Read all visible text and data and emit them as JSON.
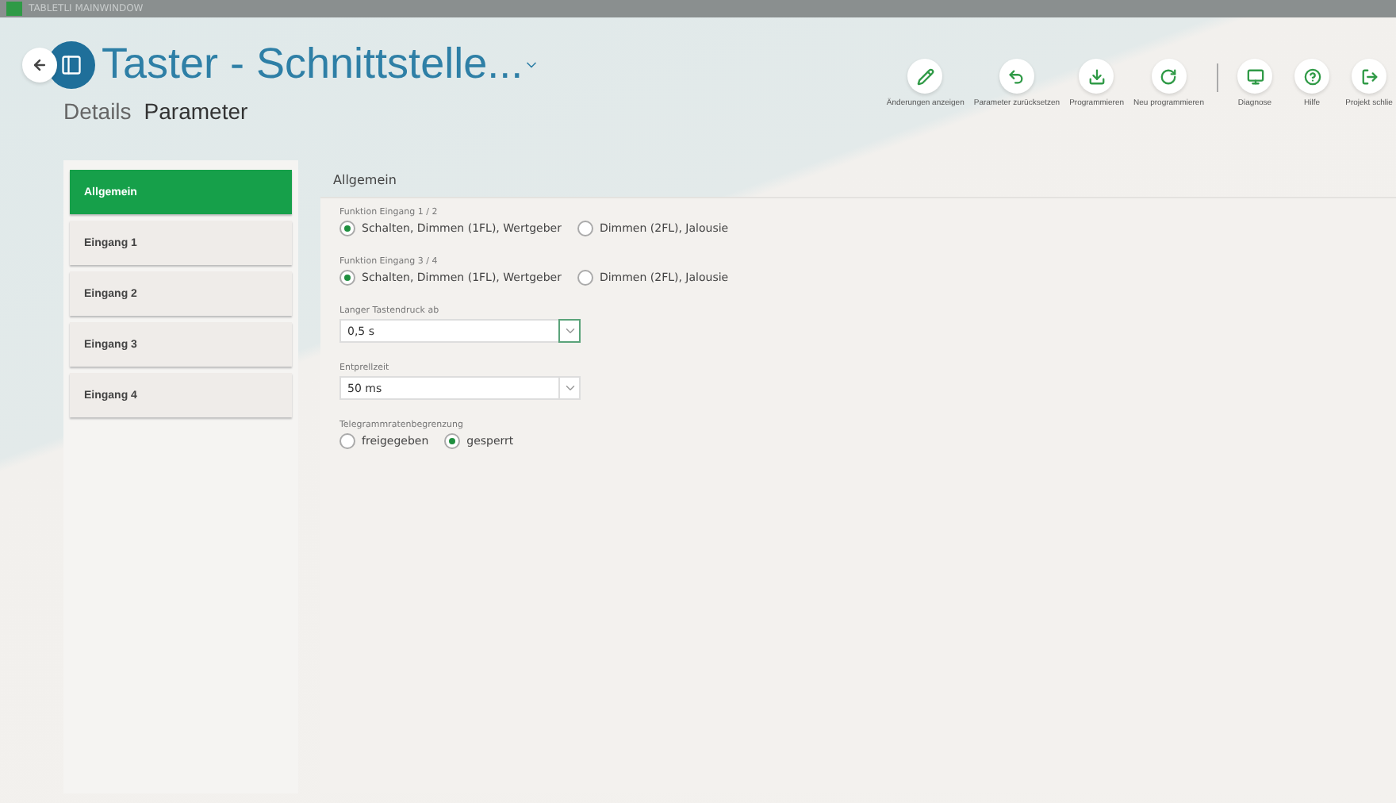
{
  "window": {
    "title": "TABLETLI MAINWINDOW"
  },
  "header": {
    "title": "Taster - Schnittstelle...",
    "tabs": [
      {
        "label": "Details",
        "selected": false
      },
      {
        "label": "Parameter",
        "selected": true
      }
    ]
  },
  "toolbar": {
    "groups": [
      [
        {
          "label": "Änderungen anzeigen"
        },
        {
          "label": "Parameter zurücksetzen"
        },
        {
          "label": "Programmieren"
        },
        {
          "label": "Neu programmieren"
        }
      ],
      [
        {
          "label": "Diagnose"
        },
        {
          "label": "Hilfe"
        },
        {
          "label": "Projekt schlie"
        }
      ]
    ]
  },
  "sidebar": {
    "items": [
      {
        "label": "Allgemein",
        "selected": true
      },
      {
        "label": "Eingang 1",
        "selected": false
      },
      {
        "label": "Eingang 2",
        "selected": false
      },
      {
        "label": "Eingang 3",
        "selected": false
      },
      {
        "label": "Eingang 4",
        "selected": false
      }
    ]
  },
  "section": {
    "title": "Allgemein",
    "fields": [
      {
        "kind": "radio",
        "label": "Funktion Eingang 1 / 2",
        "options": [
          {
            "label": "Schalten, Dimmen (1FL), Wertgeber",
            "selected": true
          },
          {
            "label": "Dimmen (2FL), Jalousie",
            "selected": false
          }
        ]
      },
      {
        "kind": "radio",
        "label": "Funktion Eingang 3 / 4",
        "options": [
          {
            "label": "Schalten, Dimmen (1FL), Wertgeber",
            "selected": true
          },
          {
            "label": "Dimmen (2FL), Jalousie",
            "selected": false
          }
        ]
      },
      {
        "kind": "dropdown",
        "label": "Langer Tastendruck ab",
        "value": "0,5 s",
        "focused": true
      },
      {
        "kind": "dropdown",
        "label": "Entprellzeit",
        "value": "50 ms",
        "focused": false
      },
      {
        "kind": "radio",
        "label": "Telegrammratenbegrenzung",
        "options": [
          {
            "label": "freigegeben",
            "selected": false
          },
          {
            "label": "gesperrt",
            "selected": true
          }
        ]
      }
    ]
  }
}
